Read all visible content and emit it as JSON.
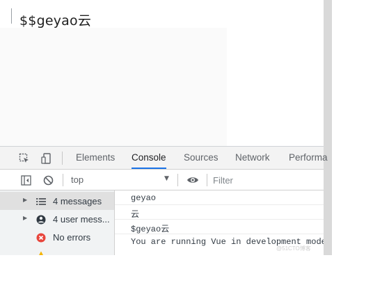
{
  "page": {
    "heading": "$$geyao云"
  },
  "devtools": {
    "tabs": [
      {
        "label": "Elements",
        "active": false
      },
      {
        "label": "Console",
        "active": true
      },
      {
        "label": "Sources",
        "active": false
      },
      {
        "label": "Network",
        "active": false
      },
      {
        "label": "Performa",
        "active": false
      }
    ],
    "toolbar": {
      "context": "top",
      "filter_placeholder": "Filter"
    },
    "sidebar": [
      {
        "label": "4 messages",
        "icon": "list-icon",
        "selected": true
      },
      {
        "label": "4 user mess...",
        "icon": "user-icon",
        "selected": false
      },
      {
        "label": "No errors",
        "icon": "error-icon",
        "selected": false
      }
    ],
    "console_lines": [
      "geyao",
      "云",
      "$geyao云",
      "You are running Vue in development mode"
    ]
  },
  "colors": {
    "accent": "#1a73e8",
    "error": "#e8453c",
    "warning": "#f4b400"
  }
}
